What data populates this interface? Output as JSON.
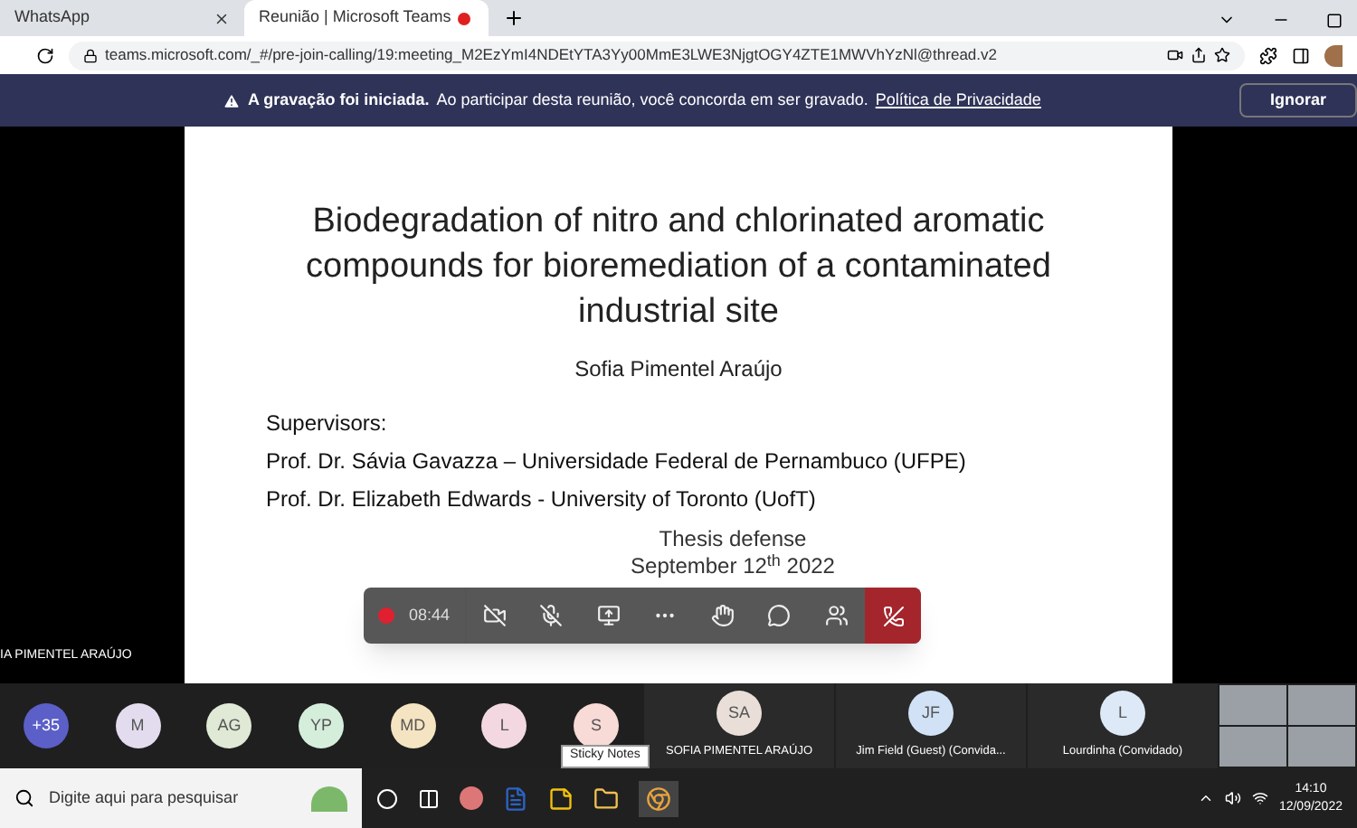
{
  "browser": {
    "tabs": [
      {
        "title": "WhatsApp",
        "selected": false,
        "recording": false
      },
      {
        "title": "Reunião | Microsoft Teams",
        "selected": true,
        "recording": true
      }
    ],
    "url": "teams.microsoft.com/_#/pre-join-calling/19:meeting_M2EzYmI4NDEtYTA3Yy00MmE3LWE3NjgtOGY4ZTE1MWVhYzNl@thread.v2"
  },
  "banner": {
    "bold": "A gravação foi iniciada.",
    "message": "Ao participar desta reunião, você concorda em ser gravado.",
    "link": "Política de Privacidade",
    "button": "Ignorar"
  },
  "slide": {
    "title": "Biodegradation of nitro and chlorinated aromatic compounds for bioremediation of a contaminated industrial site",
    "author": "Sofia Pimentel Araújo",
    "supervisors_label": "Supervisors:",
    "supervisors": [
      "Prof. Dr. Sávia Gavazza – Universidade Federal de Pernambuco (UFPE)",
      "Prof. Dr. Elizabeth Edwards - University of Toronto (UofT)"
    ],
    "footer": [
      "Thesis defense",
      "September 12$^{th}$ 2022"
    ]
  },
  "presenter_label": "IA PIMENTEL ARAÚJO",
  "call_controls": {
    "timer": "08:44",
    "recording": true
  },
  "participants": [
    {
      "initials": "+35",
      "color": "#5b5fc7"
    },
    {
      "initials": "M",
      "color": "#e3dcee"
    },
    {
      "initials": "AG",
      "color": "#dfe9d5"
    },
    {
      "initials": "YP",
      "color": "#d5eedc"
    },
    {
      "initials": "MD",
      "color": "#f5e4c2"
    },
    {
      "initials": "L",
      "color": "#f3d8e2"
    },
    {
      "initials": "S",
      "color": "#f8dad6"
    }
  ],
  "tiles": [
    {
      "initials": "SA",
      "name": "SOFIA PIMENTEL ARAÚJO",
      "color": "#e9dfd8"
    },
    {
      "initials": "JF",
      "name": "Jim Field (Guest) (Convida...",
      "color": "#d2e2f6"
    },
    {
      "initials": "L",
      "name": "Lourdinha (Convidado)",
      "color": "#dde9f6"
    }
  ],
  "taskbar": {
    "search_placeholder": "Digite aqui para pesquisar",
    "tooltip": "Sticky Notes",
    "time": "14:10",
    "date": "12/09/2022"
  }
}
